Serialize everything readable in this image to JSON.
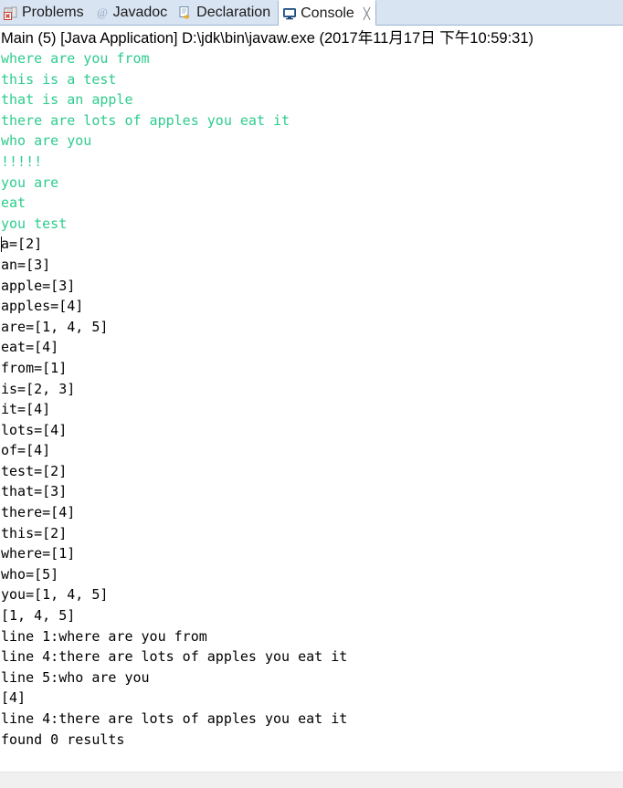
{
  "tabs": [
    {
      "label": "Problems",
      "icon": "problems-icon",
      "active": false,
      "closable": false
    },
    {
      "label": "Javadoc",
      "icon": "javadoc-at-icon",
      "active": false,
      "closable": false
    },
    {
      "label": "Declaration",
      "icon": "declaration-icon",
      "active": false,
      "closable": false
    },
    {
      "label": "Console",
      "icon": "console-monitor-icon",
      "active": true,
      "closable": true,
      "close_glyph": "╳"
    }
  ],
  "console": {
    "title": "Main (5) [Java Application] D:\\jdk\\bin\\javaw.exe (2017年11月17日 下午10:59:31)",
    "colors": {
      "stdout_green": "#2ecc8e",
      "stdout_black": "#000000",
      "tabbar_bg": "#d9e4f2",
      "active_tab_bg": "#ffffff",
      "footer_bg": "#f0f0f0"
    },
    "lines": [
      {
        "text": "where are you from",
        "color": "green"
      },
      {
        "text": "this is a test",
        "color": "green"
      },
      {
        "text": "that is an apple",
        "color": "green"
      },
      {
        "text": "there are lots of apples you eat it",
        "color": "green"
      },
      {
        "text": "who are you",
        "color": "green"
      },
      {
        "text": "!!!!!",
        "color": "green"
      },
      {
        "text": "you are",
        "color": "green"
      },
      {
        "text": "eat",
        "color": "green"
      },
      {
        "text": "you test",
        "color": "green"
      },
      {
        "text": "a=[2]",
        "color": "black"
      },
      {
        "text": "an=[3]",
        "color": "black"
      },
      {
        "text": "apple=[3]",
        "color": "black"
      },
      {
        "text": "apples=[4]",
        "color": "black"
      },
      {
        "text": "are=[1, 4, 5]",
        "color": "black"
      },
      {
        "text": "eat=[4]",
        "color": "black"
      },
      {
        "text": "from=[1]",
        "color": "black"
      },
      {
        "text": "is=[2, 3]",
        "color": "black"
      },
      {
        "text": "it=[4]",
        "color": "black"
      },
      {
        "text": "lots=[4]",
        "color": "black"
      },
      {
        "text": "of=[4]",
        "color": "black"
      },
      {
        "text": "test=[2]",
        "color": "black"
      },
      {
        "text": "that=[3]",
        "color": "black"
      },
      {
        "text": "there=[4]",
        "color": "black"
      },
      {
        "text": "this=[2]",
        "color": "black"
      },
      {
        "text": "where=[1]",
        "color": "black"
      },
      {
        "text": "who=[5]",
        "color": "black"
      },
      {
        "text": "you=[1, 4, 5]",
        "color": "black"
      },
      {
        "text": "[1, 4, 5]",
        "color": "black"
      },
      {
        "text": "line 1:where are you from",
        "color": "black"
      },
      {
        "text": "line 4:there are lots of apples you eat it",
        "color": "black"
      },
      {
        "text": "line 5:who are you",
        "color": "black"
      },
      {
        "text": "[4]",
        "color": "black"
      },
      {
        "text": "line 4:there are lots of apples you eat it",
        "color": "black"
      },
      {
        "text": "found 0 results",
        "color": "black"
      }
    ],
    "caret_line_index": 9
  }
}
